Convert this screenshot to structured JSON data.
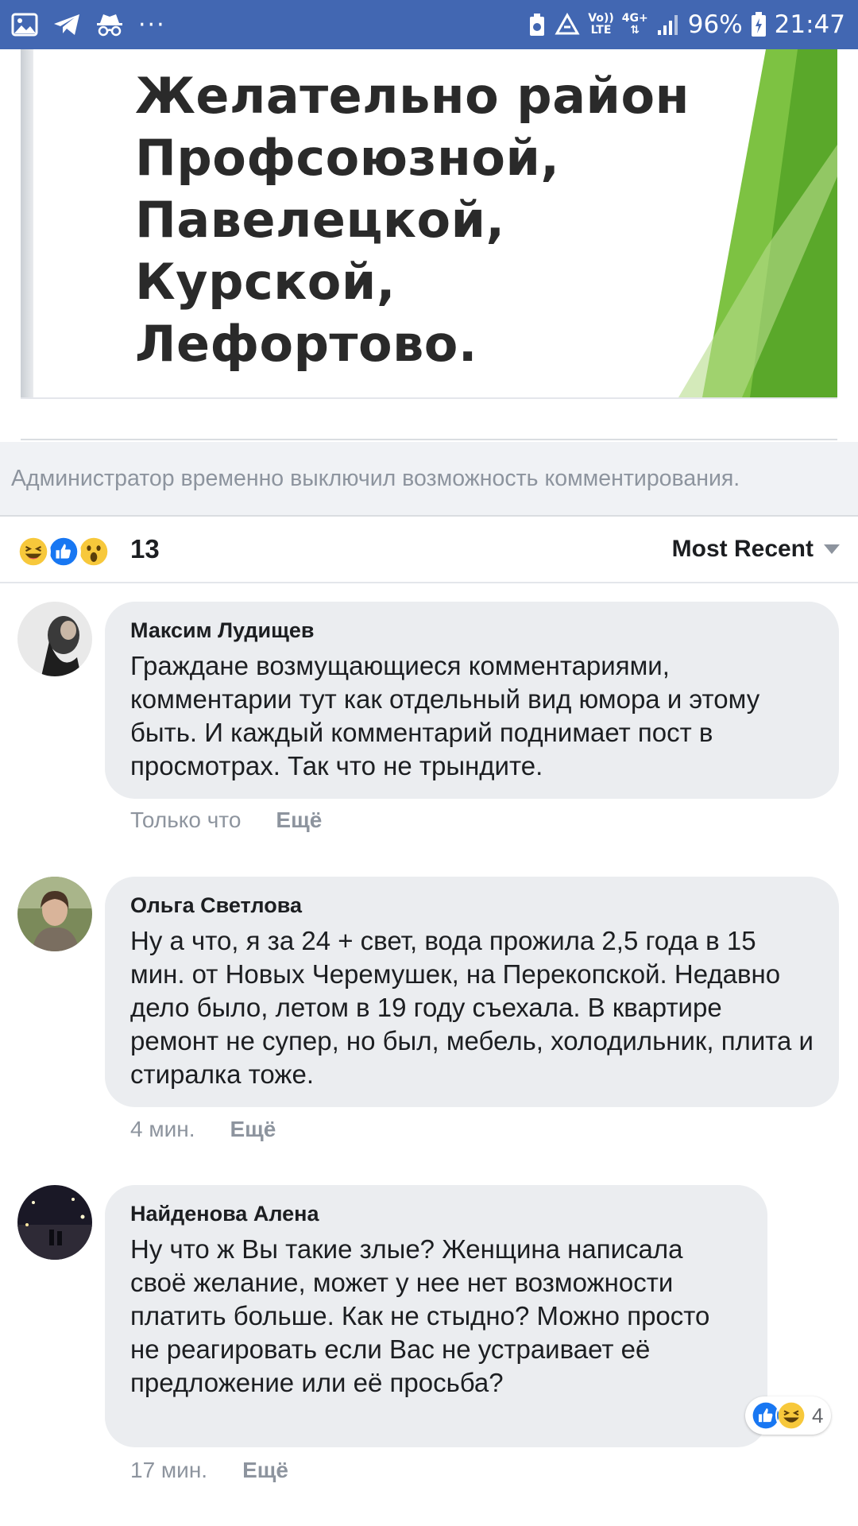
{
  "status_bar": {
    "left_icons": [
      "gallery-icon",
      "telegram-icon",
      "incognito-icon",
      "more-dots-icon"
    ],
    "network_top": "Vo))",
    "network_bottom": "LTE",
    "net_type": "4G+",
    "battery": "96%",
    "time": "21:47"
  },
  "post": {
    "image_text": "Желательно район Профсоюзной, Павелецкой, Курской, Лефортово."
  },
  "notice": {
    "text": "Администратор временно выключил возможность комментирования."
  },
  "reactions": {
    "icons": [
      "haha-icon",
      "like-icon",
      "wow-icon"
    ],
    "count": "13",
    "sort_label": "Most Recent"
  },
  "comments": [
    {
      "author": "Максим Лудищев",
      "text": "Граждане возмущающиеся комментариями, комментарии тут как отдельный вид юмора и этому быть. И каждый комментарий поднимает пост в просмотрах. Так что не трындите.",
      "time": "Только что",
      "more": "Ещё"
    },
    {
      "author": "Ольга Светлова",
      "text": "Ну а что, я за 24 + свет, вода прожила 2,5 года в 15 мин. от Новых Черемушек, на Перекопской. Недавно дело было, летом в 19 году съехала. В квартире ремонт не супер, но был, мебель, холодильник, плита и стиралка тоже.",
      "time": "4 мин.",
      "more": "Ещё"
    },
    {
      "author": "Найденова Алена",
      "text": "Ну что ж Вы такие злые? Женщина написала своё желание, может у нее нет возможности платить больше. Как не стыдно? Можно просто не реагировать если Вас не устраивает её предложение или её просьба?",
      "time": "17 мин.",
      "more": "Ещё",
      "reaction_count": "4"
    }
  ],
  "colors": {
    "brand": "#4267b2",
    "bubble": "#ebedf0",
    "muted": "#8d949e",
    "green_accent": "#6fbd2a"
  }
}
